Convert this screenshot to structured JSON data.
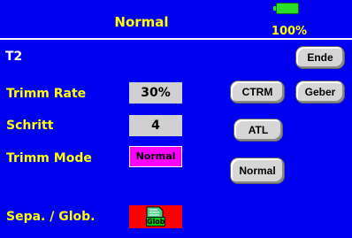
{
  "header": {
    "title": "Normal",
    "battery_percent": "100%",
    "battery_level": 1.0
  },
  "model": {
    "name": "T2"
  },
  "fields": {
    "trim_rate_label": "Trimm Rate",
    "trim_rate_value": "30%",
    "step_label": "Schritt",
    "step_value": "4",
    "trim_mode_label": "Trimm Mode",
    "trim_mode_value": "Normal",
    "sepa_glob_label": "Sepa. / Glob.",
    "sepa_glob_value": "Glob"
  },
  "buttons": {
    "ende": "Ende",
    "geber": "Geber",
    "ctrm": "CTRM",
    "atl": "ATL",
    "normal": "Normal"
  },
  "colors": {
    "background": "#0000f0",
    "label_text": "#ffff00",
    "mode_box": "#ff00ff",
    "sepa_box": "#ff0000",
    "battery": "#28e028"
  },
  "icons": {
    "battery": "battery-icon",
    "sepa_glob": "glob-sd-card-icon"
  }
}
